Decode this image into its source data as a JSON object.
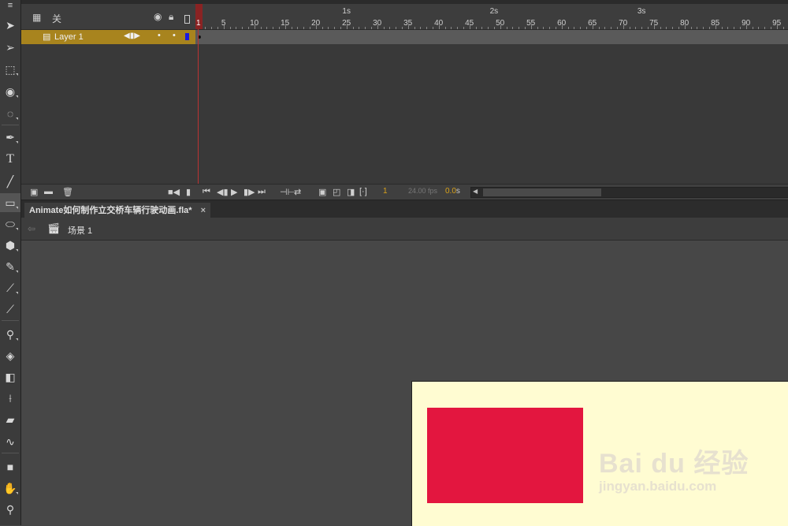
{
  "timeline": {
    "header_label": "关",
    "layer_name": "Layer 1",
    "ruler_frames": [
      "1",
      "5",
      "10",
      "15",
      "20",
      "25",
      "30",
      "35",
      "40",
      "45",
      "50",
      "55",
      "60",
      "65",
      "70",
      "75",
      "80",
      "85",
      "90",
      "95"
    ],
    "ruler_seconds": [
      "1s",
      "2s",
      "3s"
    ],
    "current_frame": "1",
    "fps": "24.00 fps",
    "time": "0.0",
    "time_unit": "s"
  },
  "document": {
    "tab_title": "Animate如何制作立交桥车辆行驶动画.fla*",
    "tab_close": "×",
    "scene_label": "场景 1"
  },
  "stage": {
    "background_color": "#fffcd2",
    "shape_color": "#e3163f"
  },
  "watermark": {
    "brand": "Bai du 经验",
    "url": "jingyan.baidu.com"
  },
  "icons": {
    "tools": [
      "selection-icon",
      "subselection-icon",
      "free-transform-icon",
      "3d-rotation-icon",
      "lasso-icon",
      "pen-icon",
      "text-icon",
      "line-icon",
      "rectangle-icon",
      "oval-icon",
      "polystar-icon",
      "pencil-icon",
      "brush-icon",
      "paint-brush-icon",
      "bone-icon",
      "paint-bucket-icon",
      "ink-bottle-icon",
      "eyedropper-icon",
      "eraser-icon",
      "width-icon",
      "camera-icon",
      "hand-icon",
      "zoom-icon"
    ]
  }
}
